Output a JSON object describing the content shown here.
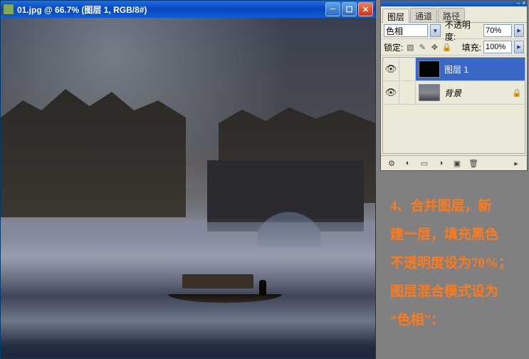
{
  "document": {
    "title": "01.jpg @ 66.7% (图层 1, RGB/8#)"
  },
  "panel": {
    "tabs": {
      "layers": "图层",
      "channels": "通道",
      "paths": "路径"
    },
    "opacity_label": "不透明度:",
    "opacity_value": "70%",
    "lock_label": "锁定:",
    "fill_label": "填充:",
    "fill_value": "100%",
    "blend_mode": "色相",
    "layers": [
      {
        "name": "图层 1",
        "selected": true,
        "thumb": "black"
      },
      {
        "name": "背景",
        "selected": false,
        "thumb": "bg",
        "locked": true
      }
    ]
  },
  "instruction": {
    "line1": "4、合并图层，新",
    "line2": "建一层，填充黑色",
    "line3": "不透明度设为70%；",
    "line4": "图层混合模式设为",
    "line5": "“色相”："
  },
  "chart_data": null
}
